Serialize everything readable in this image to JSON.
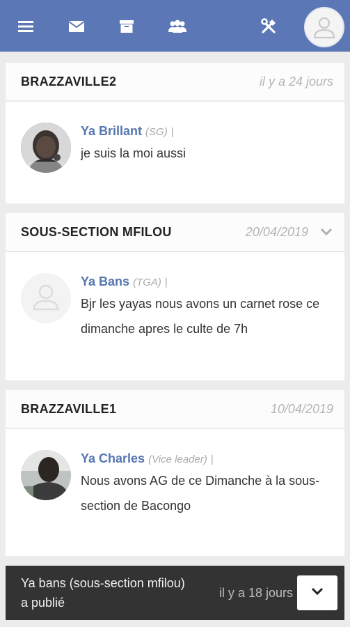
{
  "topbar": {
    "icons": [
      "menu-icon",
      "mail-icon",
      "archive-icon",
      "group-icon",
      "tools-icon",
      "user-avatar-icon"
    ],
    "color": "#5b77b5"
  },
  "cards": [
    {
      "group": "BRAZZAVILLE2",
      "date": "il y a 24 jours",
      "author": "Ya Brillant",
      "role": "(SG)",
      "separator": "|",
      "message": "je suis la moi aussi"
    },
    {
      "group": "SOUS-SECTION MFILOU",
      "date": "20/04/2019",
      "author": "Ya Bans",
      "role": "(TGA)",
      "separator": "|",
      "message": "Bjr les yayas nous avons un carnet rose ce dimanche apres le culte de 7h"
    },
    {
      "group": "BRAZZAVILLE1",
      "date": "10/04/2019",
      "author": "Ya Charles",
      "role": "(Vice leader)",
      "separator": "|",
      "message": "Nous avons AG de ce Dimanche à la sous-section de Bacongo"
    }
  ],
  "notification": {
    "text": "Ya bans (sous-section mfilou) a publié",
    "date": "il y a 18 jours"
  },
  "colors": {
    "author": "#5575b0",
    "footer": "#333333"
  }
}
